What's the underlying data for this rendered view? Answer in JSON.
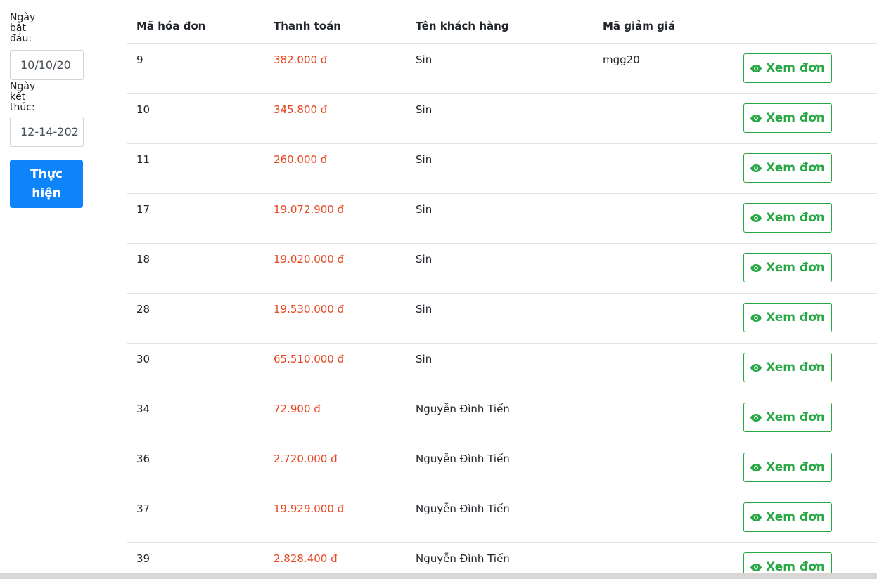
{
  "filters": {
    "start_label": "Ngày bắt đầu:",
    "start_value": "10/10/20",
    "end_label": "Ngày kết thúc:",
    "end_value": "12-14-202",
    "submit_label": "Thực hiện"
  },
  "table": {
    "headers": [
      "Mã hóa đơn",
      "Thanh toán",
      "Tên khách hàng",
      "Mã giảm giá"
    ],
    "view_label": "Xem đơn",
    "rows": [
      {
        "id": "9",
        "payment": "382.000 đ",
        "customer": "Sin",
        "coupon": "mgg20"
      },
      {
        "id": "10",
        "payment": "345.800 đ",
        "customer": "Sin",
        "coupon": ""
      },
      {
        "id": "11",
        "payment": "260.000 đ",
        "customer": "Sin",
        "coupon": ""
      },
      {
        "id": "17",
        "payment": "19.072.900 đ",
        "customer": "Sin",
        "coupon": ""
      },
      {
        "id": "18",
        "payment": "19.020.000 đ",
        "customer": "Sin",
        "coupon": ""
      },
      {
        "id": "28",
        "payment": "19.530.000 đ",
        "customer": "Sin",
        "coupon": ""
      },
      {
        "id": "30",
        "payment": "65.510.000 đ",
        "customer": "Sin",
        "coupon": ""
      },
      {
        "id": "34",
        "payment": "72.900 đ",
        "customer": "Nguyễn Đình Tiến",
        "coupon": ""
      },
      {
        "id": "36",
        "payment": "2.720.000 đ",
        "customer": "Nguyễn Đình Tiến",
        "coupon": ""
      },
      {
        "id": "37",
        "payment": "19.929.000 đ",
        "customer": "Nguyễn Đình Tiến",
        "coupon": ""
      },
      {
        "id": "39",
        "payment": "2.828.400 đ",
        "customer": "Nguyễn Đình Tiến",
        "coupon": ""
      }
    ]
  },
  "colors": {
    "primary": "#0d84fa",
    "success": "#28a745",
    "payment_text": "#e8461f"
  },
  "icons": {
    "view": "eye-icon"
  }
}
